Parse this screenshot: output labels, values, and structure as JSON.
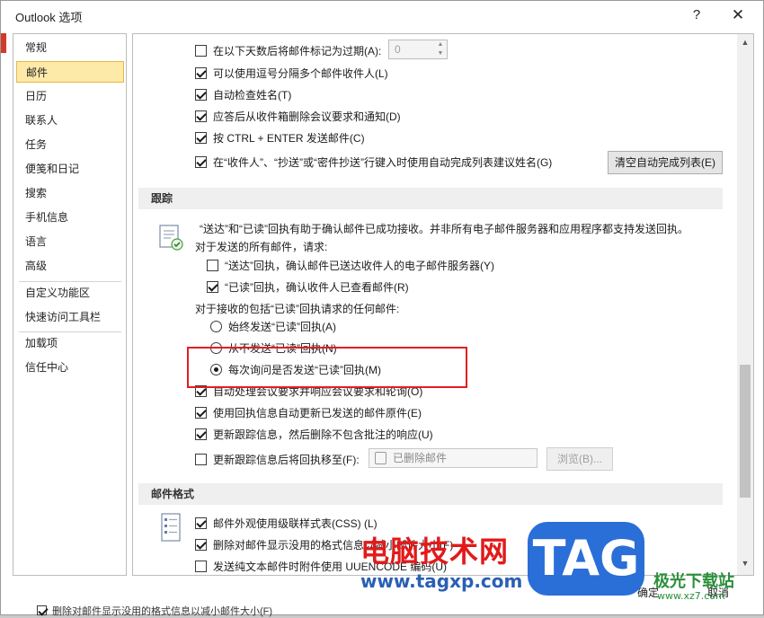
{
  "window": {
    "title": "Outlook 选项",
    "help_label": "?",
    "close_label": "✕"
  },
  "sidebar": {
    "items": [
      {
        "label": "常规"
      },
      {
        "label": "邮件",
        "selected": true
      },
      {
        "label": "日历"
      },
      {
        "label": "联系人"
      },
      {
        "label": "任务"
      },
      {
        "label": "便笺和日记"
      },
      {
        "label": "搜索"
      },
      {
        "label": "手机信息"
      },
      {
        "label": "语言"
      },
      {
        "label": "高级"
      },
      {
        "label": "自定义功能区"
      },
      {
        "label": "快速访问工具栏"
      },
      {
        "label": "加载项"
      },
      {
        "label": "信任中心"
      }
    ]
  },
  "send_options": {
    "expire": {
      "label": "在以下天数后将邮件标记为过期(A):",
      "checked": false,
      "spin_value": "0"
    },
    "comma_sep": {
      "label": "可以使用逗号分隔多个邮件收件人(L)",
      "checked": true
    },
    "check_names": {
      "label": "自动检查姓名(T)",
      "checked": true
    },
    "delete_meeting": {
      "label": "应答后从收件箱删除会议要求和通知(D)",
      "checked": true
    },
    "ctrl_enter": {
      "label": "按 CTRL + ENTER 发送邮件(C)",
      "checked": true
    },
    "autocomplete": {
      "label": "在“收件人”、“抄送”或“密件抄送”行键入时使用自动完成列表建议姓名(G)",
      "checked": true
    },
    "clear_autocomplete_button": "清空自动完成列表(E)"
  },
  "tracking": {
    "header": "跟踪",
    "intro": "“送达”和“已读”回执有助于确认邮件已成功接收。并非所有电子邮件服务器和应用程序都支持发送回执。",
    "sent_request_label": "对于发送的所有邮件，请求:",
    "delivery_receipt": {
      "label": "“送达”回执，确认邮件已送达收件人的电子邮件服务器(Y)",
      "checked": false
    },
    "read_receipt": {
      "label": "“已读”回执，确认收件人已查看邮件(R)",
      "checked": true
    },
    "received_label": "对于接收的包括“已读”回执请求的任何邮件:",
    "radio_always": {
      "label": "始终发送“已读”回执(A)",
      "checked": false
    },
    "radio_never": {
      "label": "从不发送“已读”回执(N)",
      "checked": false
    },
    "radio_ask": {
      "label": "每次询问是否发送“已读”回执(M)",
      "checked": true
    },
    "auto_process": {
      "label": "自动处理会议要求并响应会议要求和轮询(O)",
      "checked": true
    },
    "update_original": {
      "label": "使用回执信息自动更新已发送的邮件原件(E)",
      "checked": true
    },
    "update_delete": {
      "label": "更新跟踪信息，然后删除不包含批注的响应(U)",
      "checked": true
    },
    "move_after": {
      "label": "更新跟踪信息后将回执移至(F):",
      "checked": false
    },
    "folder_value": "已删除邮件",
    "browse_button": "浏览(B)..."
  },
  "message_format": {
    "header": "邮件格式",
    "css": {
      "label": "邮件外观使用级联样式表(CSS) (L)",
      "checked": true
    },
    "remove_format": {
      "label": "删除对邮件显示没用的格式信息以减小邮件大小(F)",
      "checked": true
    },
    "uuencode": {
      "label": "发送纯文本邮件时附件使用 UUENCODE 编码(U)",
      "checked": false
    }
  },
  "footer": {
    "ok_button": "确定",
    "cancel_button": "取消"
  },
  "background": {
    "bottom_text": "删除对邮件显示没用的格式信息以减小邮件大小(F)"
  },
  "watermark": {
    "cn_text": "电脑技术网",
    "url_text": "www.tagxp.com",
    "tag_text": "TAG",
    "site_text": "极光下载站",
    "site_url": "www.xz7.com"
  }
}
